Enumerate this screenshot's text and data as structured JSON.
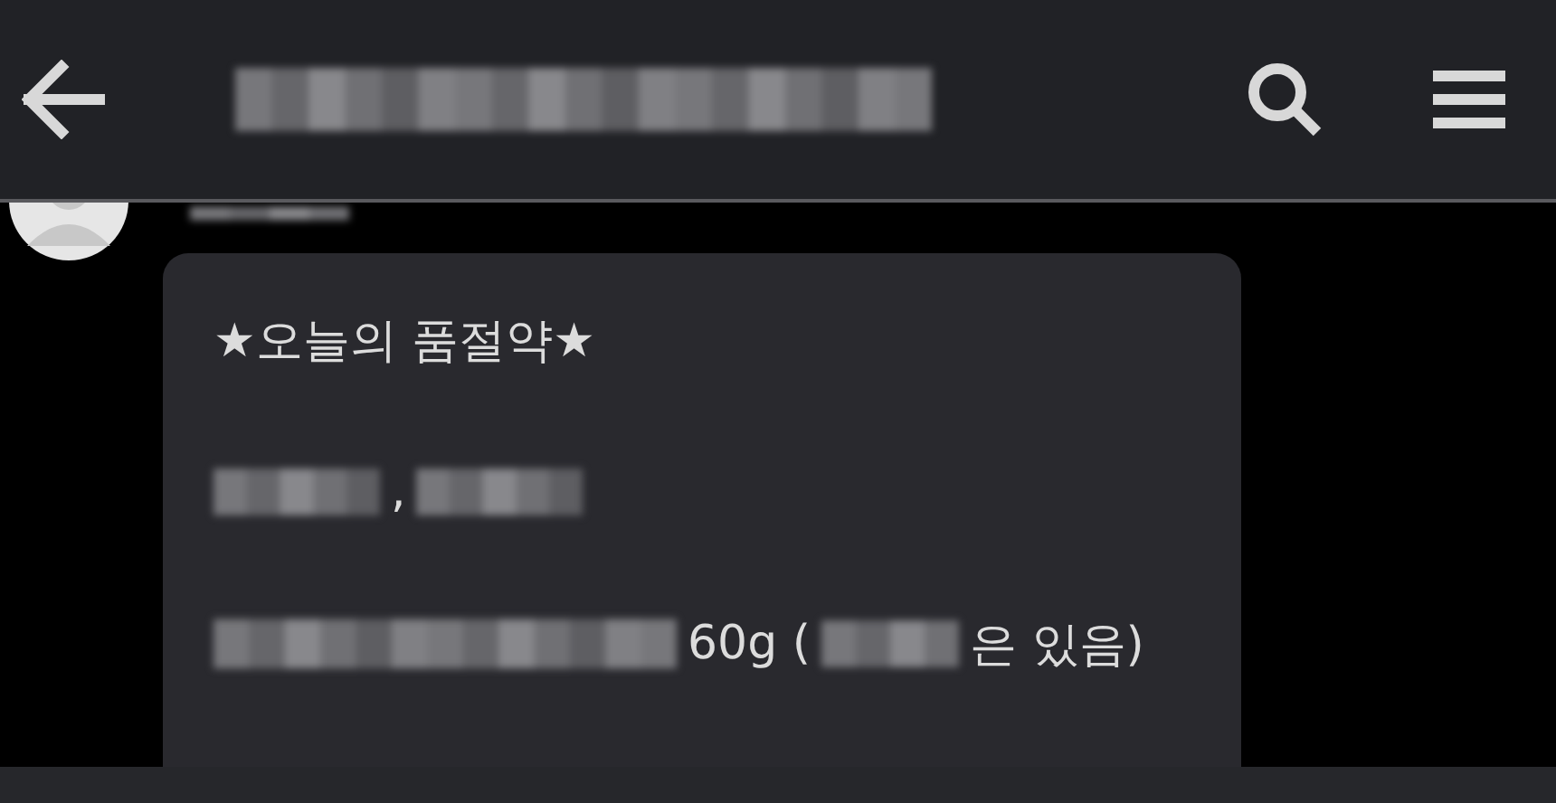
{
  "post": {
    "lines": [
      {
        "segments": [
          {
            "kind": "text",
            "text": "★오늘의 품절약★"
          }
        ]
      },
      {
        "segments": [
          {
            "kind": "redacted"
          },
          {
            "kind": "text",
            "text": ","
          },
          {
            "kind": "redacted"
          }
        ]
      },
      {
        "segments": [
          {
            "kind": "redacted"
          },
          {
            "kind": "text",
            "text": "60g ("
          },
          {
            "kind": "redacted"
          },
          {
            "kind": "text",
            "text": "은 있음)"
          }
        ]
      }
    ]
  }
}
